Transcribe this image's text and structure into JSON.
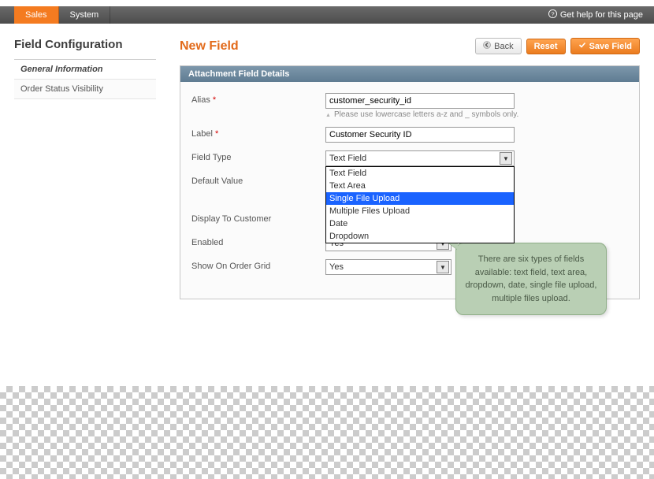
{
  "nav": {
    "tabs": [
      "Sales",
      "System"
    ],
    "active_index": 0,
    "help_label": "Get help for this page"
  },
  "sidebar": {
    "title": "Field Configuration",
    "items": [
      {
        "label": "General Information",
        "selected": true
      },
      {
        "label": "Order Status Visibility",
        "selected": false
      }
    ]
  },
  "page": {
    "title": "New Field",
    "buttons": {
      "back": "Back",
      "reset": "Reset",
      "save": "Save Field"
    }
  },
  "box": {
    "title": "Attachment Field Details"
  },
  "form": {
    "alias": {
      "label": "Alias",
      "required": true,
      "value": "customer_security_id",
      "hint": "Please use lowercase letters a-z and _ symbols only."
    },
    "label": {
      "label": "Label",
      "required": true,
      "value": "Customer Security ID"
    },
    "field_type": {
      "label": "Field Type",
      "selected": "Text Field",
      "options": [
        "Text Field",
        "Text Area",
        "Single File Upload",
        "Multiple Files Upload",
        "Date",
        "Dropdown"
      ],
      "highlighted_index": 2
    },
    "default_value": {
      "label": "Default Value"
    },
    "display_to_customer": {
      "label": "Display To Customer"
    },
    "enabled": {
      "label": "Enabled",
      "value": "Yes"
    },
    "show_on_order_grid": {
      "label": "Show On Order Grid",
      "value": "Yes"
    }
  },
  "callout": {
    "text": "There are six types of fields available: text field, text area, dropdown, date, single file upload, multiple files upload."
  }
}
